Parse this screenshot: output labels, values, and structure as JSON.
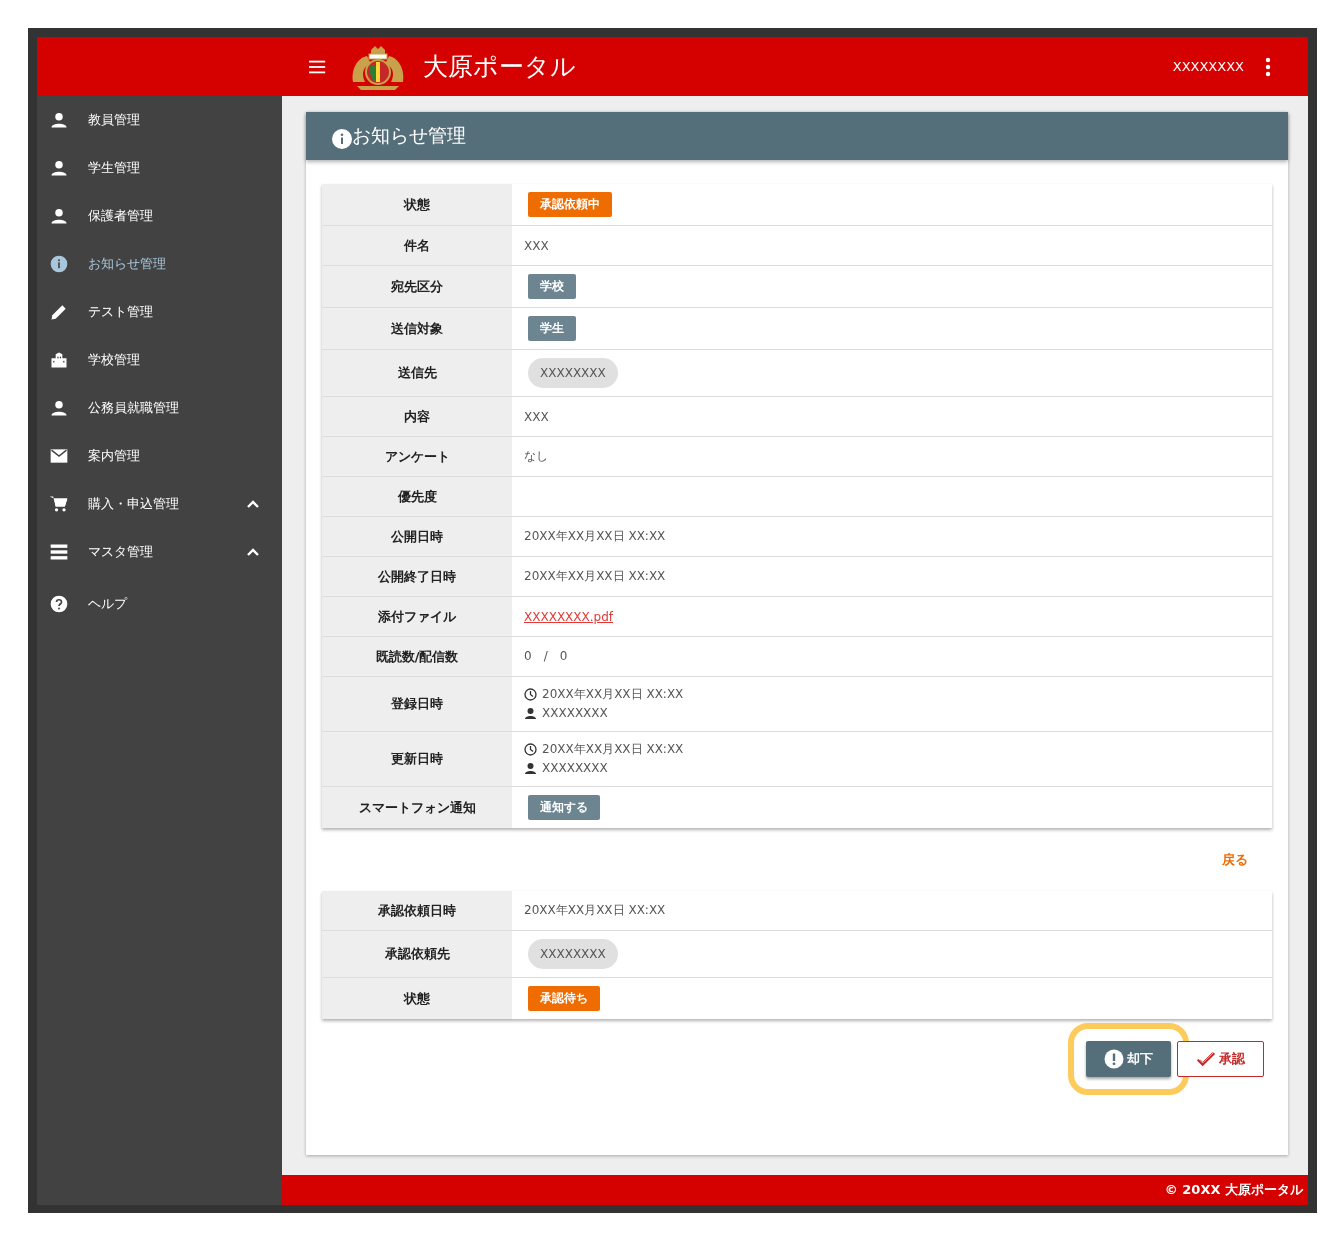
{
  "header": {
    "title": "大原ポータル",
    "user": "XXXXXXXX"
  },
  "sidebar": {
    "items": [
      {
        "label": "教員管理",
        "selected": false
      },
      {
        "label": "学生管理",
        "selected": false
      },
      {
        "label": "保護者管理",
        "selected": false
      },
      {
        "label": "お知らせ管理",
        "selected": true
      },
      {
        "label": "テスト管理",
        "selected": false
      },
      {
        "label": "学校管理",
        "selected": false
      },
      {
        "label": "公務員就職管理",
        "selected": false
      },
      {
        "label": "案内管理",
        "selected": false
      },
      {
        "label": "購入・申込管理",
        "selected": false,
        "expanded": true
      },
      {
        "label": "マスタ管理",
        "selected": false,
        "expanded": true
      },
      {
        "label": "ヘルプ",
        "selected": false
      }
    ]
  },
  "page": {
    "title": "お知らせ管理"
  },
  "details": {
    "rows": [
      {
        "label": "状態",
        "kind": "badge",
        "value": "承認依頼中",
        "color": "#ef6c00"
      },
      {
        "label": "件名",
        "kind": "text",
        "value": "XXX"
      },
      {
        "label": "宛先区分",
        "kind": "badge",
        "value": "学校",
        "color": "#6d8591"
      },
      {
        "label": "送信対象",
        "kind": "badge",
        "value": "学生",
        "color": "#6d8591"
      },
      {
        "label": "送信先",
        "kind": "chip",
        "value": "XXXXXXXX"
      },
      {
        "label": "内容",
        "kind": "text",
        "value": "XXX"
      },
      {
        "label": "アンケート",
        "kind": "text",
        "value": "なし"
      },
      {
        "label": "優先度",
        "kind": "empty"
      },
      {
        "label": "公開日時",
        "kind": "text",
        "value": "20XX年XX月XX日 XX:XX"
      },
      {
        "label": "公開終了日時",
        "kind": "text",
        "value": "20XX年XX月XX日 XX:XX"
      },
      {
        "label": "添付ファイル",
        "kind": "link",
        "value": "XXXXXXXX.pdf"
      },
      {
        "label": "既読数/配信数",
        "kind": "text",
        "value": "0　/　0"
      },
      {
        "label": "登録日時",
        "kind": "meta",
        "time": "20XX年XX月XX日 XX:XX",
        "user": "XXXXXXXX"
      },
      {
        "label": "更新日時",
        "kind": "meta",
        "time": "20XX年XX月XX日 XX:XX",
        "user": "XXXXXXXX"
      },
      {
        "label": "スマートフォン通知",
        "kind": "badge",
        "value": "通知する",
        "color": "#6d8591"
      }
    ]
  },
  "back_link": "戻る",
  "approval": {
    "rows": [
      {
        "label": "承認依頼日時",
        "kind": "text",
        "value": "20XX年XX月XX日 XX:XX"
      },
      {
        "label": "承認依頼先",
        "kind": "chip",
        "value": "XXXXXXXX"
      },
      {
        "label": "状態",
        "kind": "badge",
        "value": "承認待ち",
        "color": "#ef6c00"
      }
    ]
  },
  "buttons": [
    {
      "kind": "reject",
      "label": "却下",
      "highlighted": true
    },
    {
      "kind": "approve",
      "label": "承認",
      "highlighted": false
    }
  ],
  "footer": "© 20XX 大原ポータル"
}
